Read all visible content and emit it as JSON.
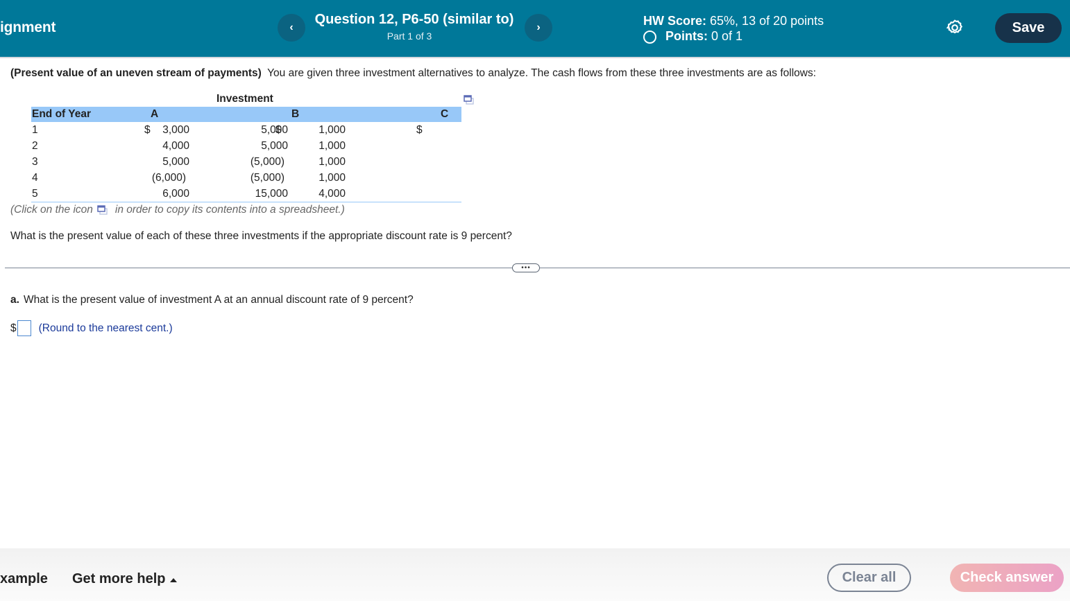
{
  "header": {
    "assignment_title": "ignment",
    "question_title": "Question 12, P6-50 (similar to)",
    "part": "Part 1 of 3",
    "prev_icon": "chevron-left-icon",
    "next_icon": "chevron-right-icon",
    "hw_score_label": "HW Score:",
    "hw_score_value": "65%, 13 of 20 points",
    "points_label": "Points:",
    "points_value": "0 of 1",
    "settings_icon": "gear-icon",
    "save_label": "Save",
    "colors": {
      "bar": "#007899",
      "save_bg": "#17324a",
      "nav_btn": "#0b6381"
    }
  },
  "problem": {
    "intro_bold": "(Present value of an uneven stream of payments)",
    "intro_text": "You are given three investment alternatives to analyze.  The cash flows from these three investments are as follows:",
    "table_title": "Investment",
    "columns": [
      "End of Year",
      "A",
      "B",
      "C"
    ],
    "rows": [
      {
        "year": "1",
        "a": "3,000",
        "a_dollar": "$",
        "b": "1,000",
        "b_dollar": "$",
        "c": "5,000",
        "c_dollar": "$"
      },
      {
        "year": "2",
        "a": "4,000",
        "a_dollar": "",
        "b": "1,000",
        "b_dollar": "",
        "c": "5,000",
        "c_dollar": ""
      },
      {
        "year": "3",
        "a": "5,000",
        "a_dollar": "",
        "b": "1,000",
        "b_dollar": "",
        "c": "(5,000)",
        "c_dollar": ""
      },
      {
        "year": "4",
        "a": "(6,000)",
        "a_dollar": "",
        "b": "1,000",
        "b_dollar": "",
        "c": "(5,000)",
        "c_dollar": ""
      },
      {
        "year": "5",
        "a": "6,000",
        "a_dollar": "",
        "b": "4,000",
        "b_dollar": "",
        "c": "15,000",
        "c_dollar": ""
      }
    ],
    "copy_note_before": "(Click on the icon",
    "copy_note_after": "in order to copy its contents into a spreadsheet.)",
    "question": "What is the present value of each of these three investments if the appropriate discount rate is 9 percent?",
    "more_label": "•••",
    "table_header_color": "#98c8f8"
  },
  "part_a": {
    "label": "a.",
    "question": "What is the present value of investment A at an annual discount rate of 9 percent?",
    "currency": "$",
    "answer_value": "",
    "answer_placeholder": "",
    "hint": "(Round to the nearest cent.)"
  },
  "footer": {
    "example_label": "xample",
    "help_label": "Get more help",
    "help_icon": "triangle-up-icon",
    "clear_label": "Clear all",
    "check_label": "Check answer"
  }
}
